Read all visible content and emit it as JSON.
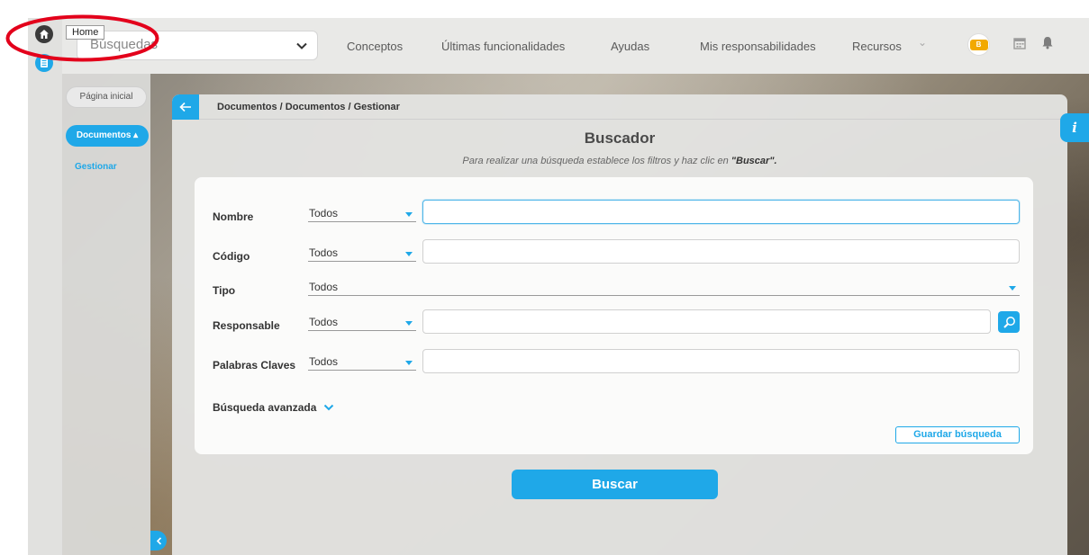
{
  "topbar": {
    "home_tooltip": "Home",
    "search_value": "Búsquedas",
    "nav": [
      "Conceptos",
      "Últimas funcionalidades",
      "Ayudas",
      "Mis responsabilidades",
      "Recursos"
    ],
    "avatar_text": "B"
  },
  "sidebar": {
    "home_button": "Página inicial",
    "section": "Documentos ▴",
    "active_link": "Gestionar"
  },
  "main": {
    "breadcrumb": "Documentos / Documentos / Gestionar",
    "title": "Buscador",
    "subtitle_prefix": "Para realizar una búsqueda establece los filtros y haz clic en ",
    "subtitle_emph": "\"Buscar\".",
    "filters": [
      {
        "label": "Nombre",
        "operator": "Todos"
      },
      {
        "label": "Código",
        "operator": "Todos"
      },
      {
        "label": "Tipo",
        "operator": "Todos"
      },
      {
        "label": "Responsable",
        "operator": "Todos"
      },
      {
        "label": "Palabras Claves",
        "operator": "Todos"
      }
    ],
    "advanced_label": "Búsqueda avanzada",
    "save_search_label": "Guardar búsqueda",
    "search_button_label": "Buscar",
    "info_label": "i"
  },
  "colors": {
    "accent": "#1fa8e8",
    "highlight": "#e3001b"
  }
}
